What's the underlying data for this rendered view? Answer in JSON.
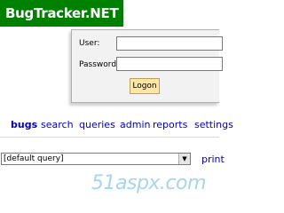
{
  "header": {
    "logo": "BugTracker.NET"
  },
  "login": {
    "user_label": "User:",
    "password_label": "Password:",
    "user_value": "",
    "password_value": "",
    "logon_button": "Logon"
  },
  "nav": {
    "items": [
      "bugs",
      "search",
      "queries",
      "admin",
      "reports",
      "settings"
    ]
  },
  "query_bar": {
    "selected": "[default query]",
    "print_link": "print"
  },
  "watermark": "51aspx.com",
  "colors": {
    "logo_bg": "#008000",
    "login_bg": "#f2f2f2",
    "button_bg": "#ffe7a3",
    "link": "#0000cc",
    "watermark": "#a6d6e8"
  }
}
